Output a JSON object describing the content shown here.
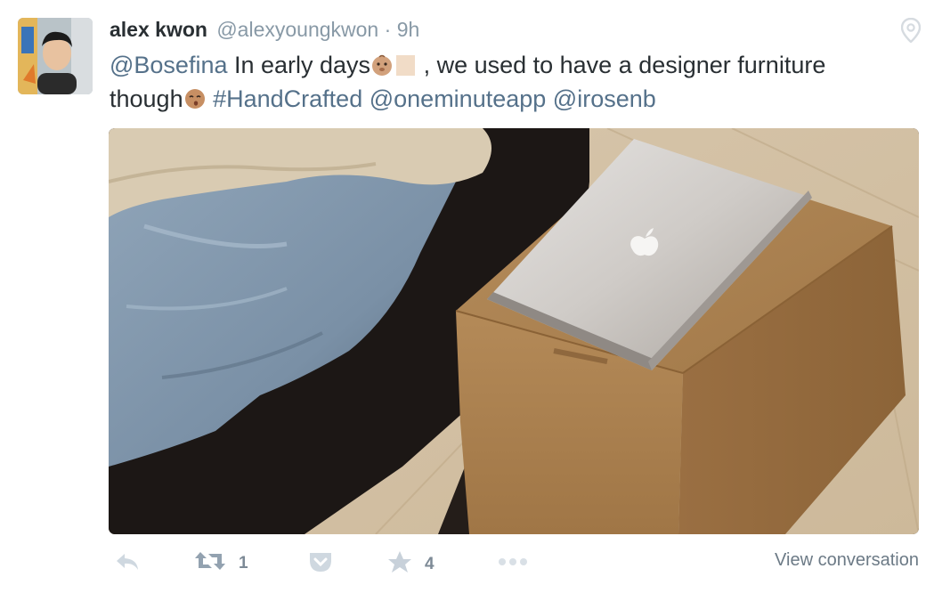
{
  "tweet": {
    "author_name": "alex kwon",
    "author_handle": "@alexyoungkwon",
    "separator": "·",
    "time": "9h",
    "text_parts": {
      "mention1": "@Bosefina",
      "t1": " In early days",
      "t2": " , we used to have a designer furniture",
      "t3": "though",
      "hashtag": "#HandCrafted",
      "mention2": "@oneminuteapp",
      "mention3": "@irosenb"
    },
    "emojis": [
      "baby-face-emoji",
      "missing-glyph-box",
      "kissing-face-emoji"
    ],
    "media_alt_icons": [
      "bed",
      "laptop",
      "cardboard-box"
    ]
  },
  "actions": {
    "reply_icon": "reply-icon",
    "retweet_icon": "retweet-icon",
    "retweet_count": "1",
    "pocket_icon": "pocket-icon",
    "favorite_icon": "star-icon",
    "favorite_count": "4",
    "more_icon": "ellipsis-icon",
    "view_conversation": "View conversation"
  },
  "colors": {
    "link": "#55718a",
    "muted": "#8899a6",
    "text": "#292f33",
    "icon": "#c8d1da"
  }
}
